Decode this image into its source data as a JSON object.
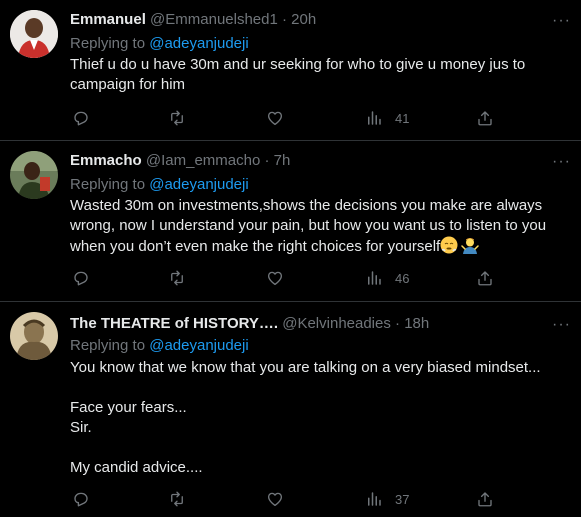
{
  "tweets": [
    {
      "name": "Emmanuel",
      "handle": "@Emmanuelshed1",
      "time": "20h",
      "replying_label": "Replying to",
      "replying_handle": "@adeyanjudeji",
      "lines": [
        "Thief u do u have 30m and ur seeking for who to give u money jus to",
        "campaign for him"
      ],
      "views": "41",
      "avatar_color": "#c9302c"
    },
    {
      "name": "Emmacho",
      "handle": "@Iam_emmacho",
      "time": "7h",
      "replying_label": "Replying to",
      "replying_handle": "@adeyanjudeji",
      "lines": [
        "Wasted 30m on investments,shows the decisions you make are always",
        "wrong, now I understand your pain, but how you want us to listen to you",
        "when you don’t even make the right choices for yourself"
      ],
      "views": "46",
      "emojis": [
        "face-with-steam-icon",
        "man-shrugging-icon"
      ],
      "avatar_color": "#3b5a2a"
    },
    {
      "name": "The THEATRE of HISTORY….",
      "handle": "@Kelvinheadies",
      "time": "18h",
      "replying_label": "Replying to",
      "replying_handle": "@adeyanjudeji",
      "paragraphs": [
        "You know that we know that you are talking on a very biased mindset...",
        "Face your fears...\nSir.",
        "My candid advice...."
      ],
      "views": "37",
      "avatar_color": "#a08a64"
    }
  ],
  "separator_dot": "·",
  "more_glyph": "···"
}
